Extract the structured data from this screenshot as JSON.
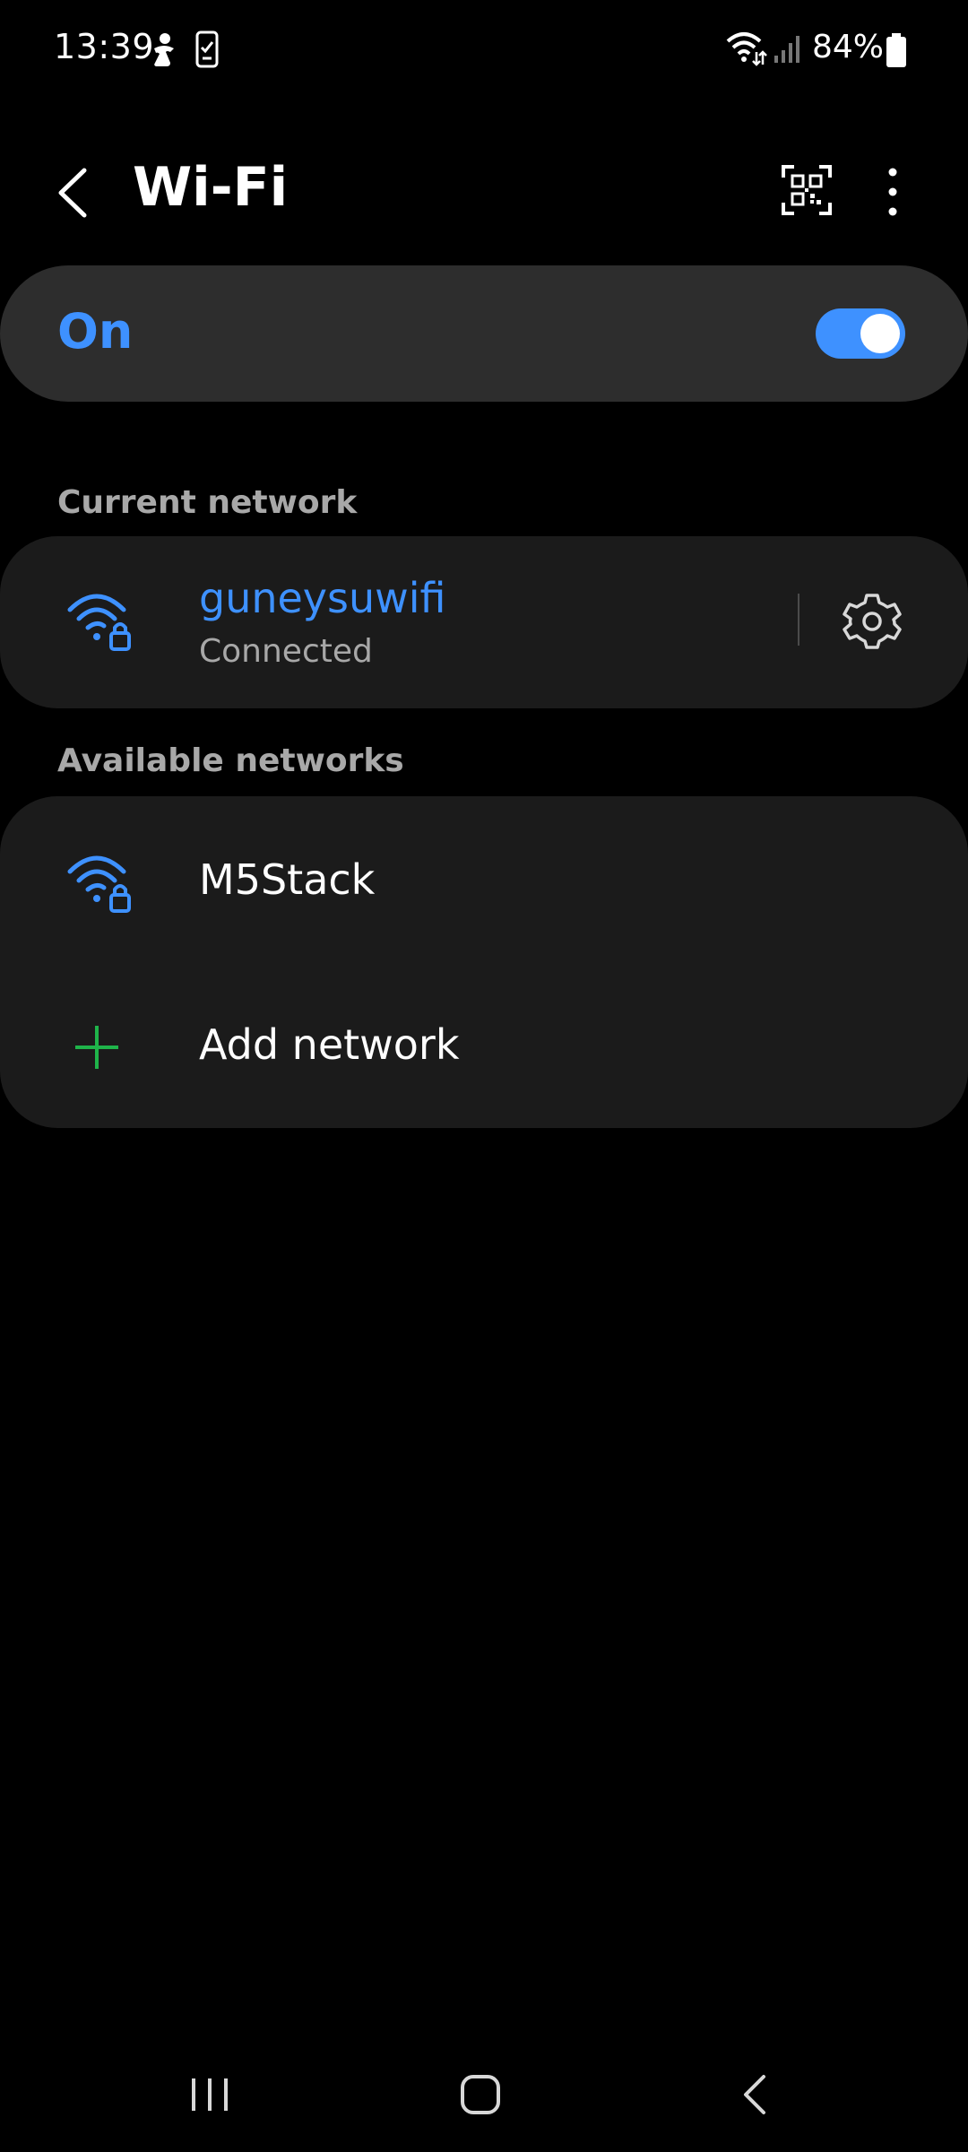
{
  "status_bar": {
    "time": "13:39",
    "battery": "84%",
    "icons": [
      "accessibility-icon",
      "phone-check-icon",
      "wifi-data-icon",
      "cellular-signal-icon",
      "battery-icon"
    ]
  },
  "header": {
    "title": "Wi-Fi",
    "icons": [
      "back-icon",
      "qr-scan-icon",
      "more-options-icon"
    ]
  },
  "toggle": {
    "label": "On",
    "state": "on"
  },
  "current_section": {
    "header": "Current network",
    "network": {
      "name": "guneysuwifi",
      "status": "Connected"
    }
  },
  "available_section": {
    "header": "Available networks",
    "networks": [
      {
        "name": "M5Stack"
      }
    ],
    "add_label": "Add network"
  },
  "colors": {
    "accent": "#3e91ff",
    "background": "#000000",
    "card": "#1b1b1b",
    "toggle_card": "#2d2d2d",
    "secondary_text": "#a8a8a8",
    "add_icon": "#1fb44a"
  },
  "nav_bar": {
    "icons": [
      "recents-icon",
      "home-icon",
      "back-nav-icon"
    ]
  }
}
